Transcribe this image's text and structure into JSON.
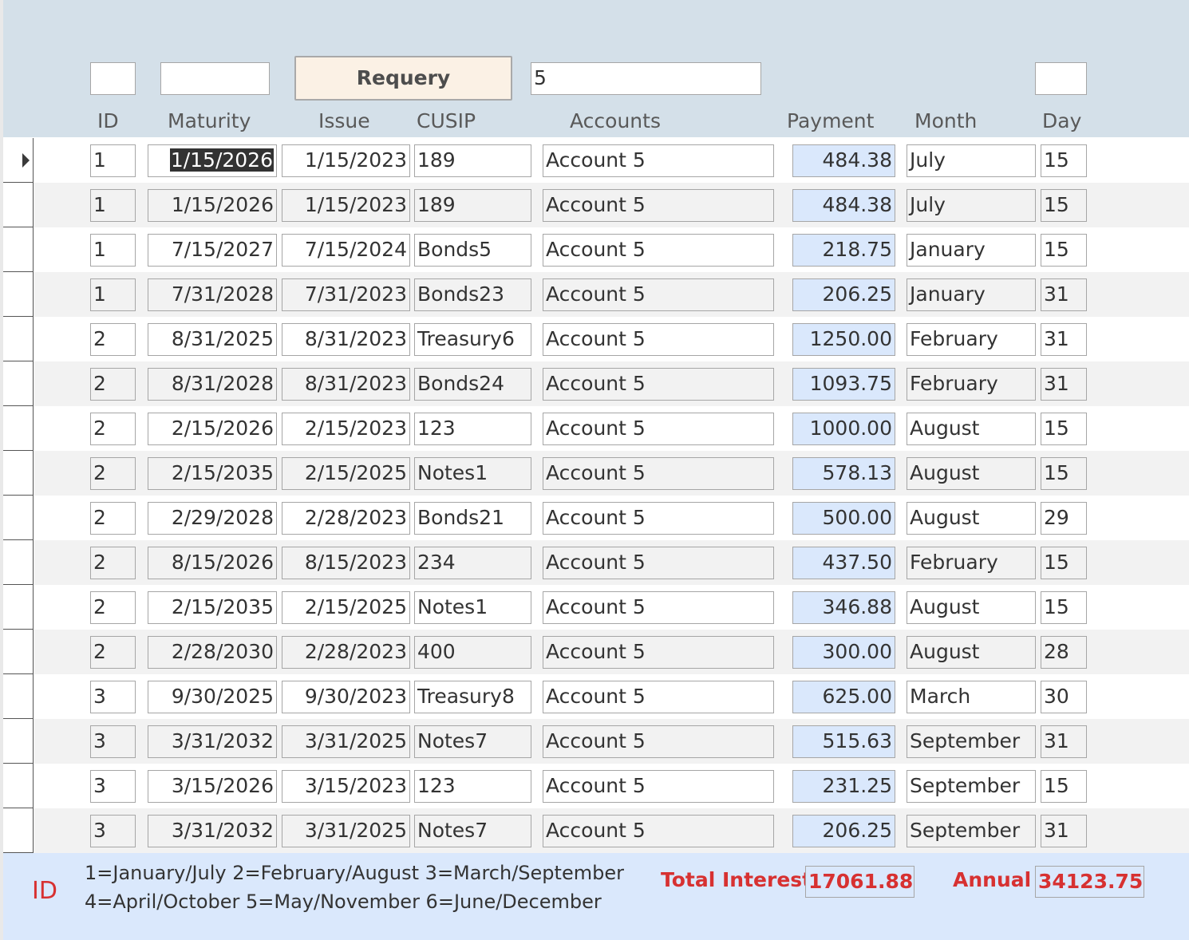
{
  "header": {
    "id_filter_value": "",
    "maturity_filter_value": "",
    "requery_label": "Requery",
    "accounts_filter_value": "5",
    "day_filter_value": ""
  },
  "columns": {
    "id": "ID",
    "maturity": "Maturity",
    "issue": "Issue",
    "cusip": "CUSIP",
    "accounts": "Accounts",
    "payment": "Payment",
    "month": "Month",
    "day": "Day"
  },
  "rows": [
    {
      "id": "1",
      "maturity": "1/15/2026",
      "issue": "1/15/2023",
      "cusip": "189",
      "account": "Account 5",
      "payment": "484.38",
      "month": "July",
      "day": "15"
    },
    {
      "id": "1",
      "maturity": "1/15/2026",
      "issue": "1/15/2023",
      "cusip": "189",
      "account": "Account 5",
      "payment": "484.38",
      "month": "July",
      "day": "15"
    },
    {
      "id": "1",
      "maturity": "7/15/2027",
      "issue": "7/15/2024",
      "cusip": "Bonds5",
      "account": "Account 5",
      "payment": "218.75",
      "month": "January",
      "day": "15"
    },
    {
      "id": "1",
      "maturity": "7/31/2028",
      "issue": "7/31/2023",
      "cusip": "Bonds23",
      "account": "Account 5",
      "payment": "206.25",
      "month": "January",
      "day": "31"
    },
    {
      "id": "2",
      "maturity": "8/31/2025",
      "issue": "8/31/2023",
      "cusip": "Treasury6",
      "account": "Account 5",
      "payment": "1250.00",
      "month": "February",
      "day": "31"
    },
    {
      "id": "2",
      "maturity": "8/31/2028",
      "issue": "8/31/2023",
      "cusip": "Bonds24",
      "account": "Account 5",
      "payment": "1093.75",
      "month": "February",
      "day": "31"
    },
    {
      "id": "2",
      "maturity": "2/15/2026",
      "issue": "2/15/2023",
      "cusip": "123",
      "account": "Account 5",
      "payment": "1000.00",
      "month": "August",
      "day": "15"
    },
    {
      "id": "2",
      "maturity": "2/15/2035",
      "issue": "2/15/2025",
      "cusip": "Notes1",
      "account": "Account 5",
      "payment": "578.13",
      "month": "August",
      "day": "15"
    },
    {
      "id": "2",
      "maturity": "2/29/2028",
      "issue": "2/28/2023",
      "cusip": "Bonds21",
      "account": "Account 5",
      "payment": "500.00",
      "month": "August",
      "day": "29"
    },
    {
      "id": "2",
      "maturity": "8/15/2026",
      "issue": "8/15/2023",
      "cusip": "234",
      "account": "Account 5",
      "payment": "437.50",
      "month": "February",
      "day": "15"
    },
    {
      "id": "2",
      "maturity": "2/15/2035",
      "issue": "2/15/2025",
      "cusip": "Notes1",
      "account": "Account 5",
      "payment": "346.88",
      "month": "August",
      "day": "15"
    },
    {
      "id": "2",
      "maturity": "2/28/2030",
      "issue": "2/28/2023",
      "cusip": "400",
      "account": "Account 5",
      "payment": "300.00",
      "month": "August",
      "day": "28"
    },
    {
      "id": "3",
      "maturity": "9/30/2025",
      "issue": "9/30/2023",
      "cusip": "Treasury8",
      "account": "Account 5",
      "payment": "625.00",
      "month": "March",
      "day": "30"
    },
    {
      "id": "3",
      "maturity": "3/31/2032",
      "issue": "3/31/2025",
      "cusip": "Notes7",
      "account": "Account 5",
      "payment": "515.63",
      "month": "September",
      "day": "31"
    },
    {
      "id": "3",
      "maturity": "3/15/2026",
      "issue": "3/15/2023",
      "cusip": "123",
      "account": "Account 5",
      "payment": "231.25",
      "month": "September",
      "day": "15"
    },
    {
      "id": "3",
      "maturity": "3/31/2032",
      "issue": "3/31/2025",
      "cusip": "Notes7",
      "account": "Account 5",
      "payment": "206.25",
      "month": "September",
      "day": "31"
    }
  ],
  "footer": {
    "id_label": "ID",
    "legend_line1": "1=January/July  2=February/August  3=March/September",
    "legend_line2": "4=April/October  5=May/November  6=June/December",
    "total_interest_label": "Total Interest",
    "total_interest_value": "17061.88",
    "annual_label": "Annual",
    "annual_value": "34123.75"
  },
  "colors": {
    "header_band": "#d4e0e9",
    "payment_field": "#dae8fc",
    "footer_band": "#dae8fc",
    "accent_red": "#d73131",
    "button_fill": "#fbf1e5"
  }
}
